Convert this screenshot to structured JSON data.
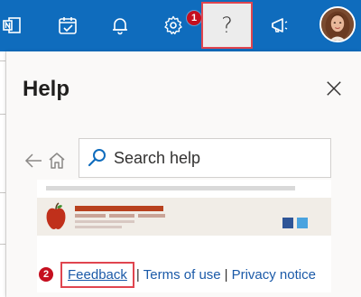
{
  "toolbar": {
    "background_color": "#0f6cbd",
    "icons": [
      "onenote-icon",
      "calendar-check-icon",
      "bell-icon",
      "gear-icon",
      "help-icon",
      "megaphone-icon"
    ],
    "help_label": "?",
    "avatar": "user-avatar"
  },
  "annotations": {
    "badge_1": "1",
    "badge_2": "2",
    "highlight_color": "#e0454f",
    "badge_color": "#c50f1f"
  },
  "help_panel": {
    "title": "Help",
    "search": {
      "placeholder": "Search help"
    },
    "footer": {
      "feedback": "Feedback",
      "separator": "|",
      "terms": "Terms of use",
      "privacy": "Privacy notice"
    }
  },
  "colors": {
    "link": "#1b5aa8",
    "panel_bg": "#faf9f8",
    "illustration_accent": "#b8411e",
    "illustration_blue_dark": "#2f5597",
    "illustration_blue_light": "#4aa3df"
  }
}
